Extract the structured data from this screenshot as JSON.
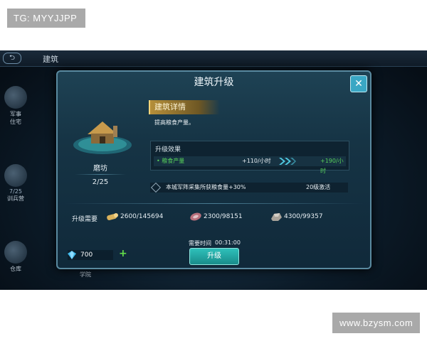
{
  "watermarks": {
    "top": "TG: MYYJJPP",
    "bottom": "www.bzysm.com"
  },
  "background": {
    "title": "建筑",
    "back_label": "⮌",
    "side_items": [
      {
        "name": "军事",
        "sub": "住宅"
      },
      {
        "level": "7/25",
        "name": "训兵营"
      },
      {
        "name": "仓库"
      }
    ],
    "bottom_label": "学院"
  },
  "dialog": {
    "title": "建筑升级",
    "close_label": "✕",
    "building": {
      "name": "磨坊",
      "level": "2/25"
    },
    "detail_heading": "建筑详情",
    "description": "提高粮食产量。",
    "effect": {
      "title": "升级效果",
      "name": "• 粮食产量",
      "current": "+110/小时",
      "next": "+190/小时"
    },
    "unlock": {
      "text": "本城军阵采集所获粮食量+30%",
      "level": "20级激活"
    },
    "requirements": {
      "label": "升级需要",
      "items": [
        {
          "icon": "wood-icon",
          "value": "2600/145694"
        },
        {
          "icon": "meat-icon",
          "value": "2300/98151"
        },
        {
          "icon": "stone-icon",
          "value": "4300/99357"
        }
      ]
    },
    "time": {
      "label": "需要时间",
      "value": "00:31:00"
    },
    "upgrade_label": "升级",
    "gems": {
      "value": "700",
      "plus": "+"
    }
  },
  "colors": {
    "accent": "#3aa7c4",
    "green": "#57d05a",
    "gold": "#b58f3a"
  }
}
